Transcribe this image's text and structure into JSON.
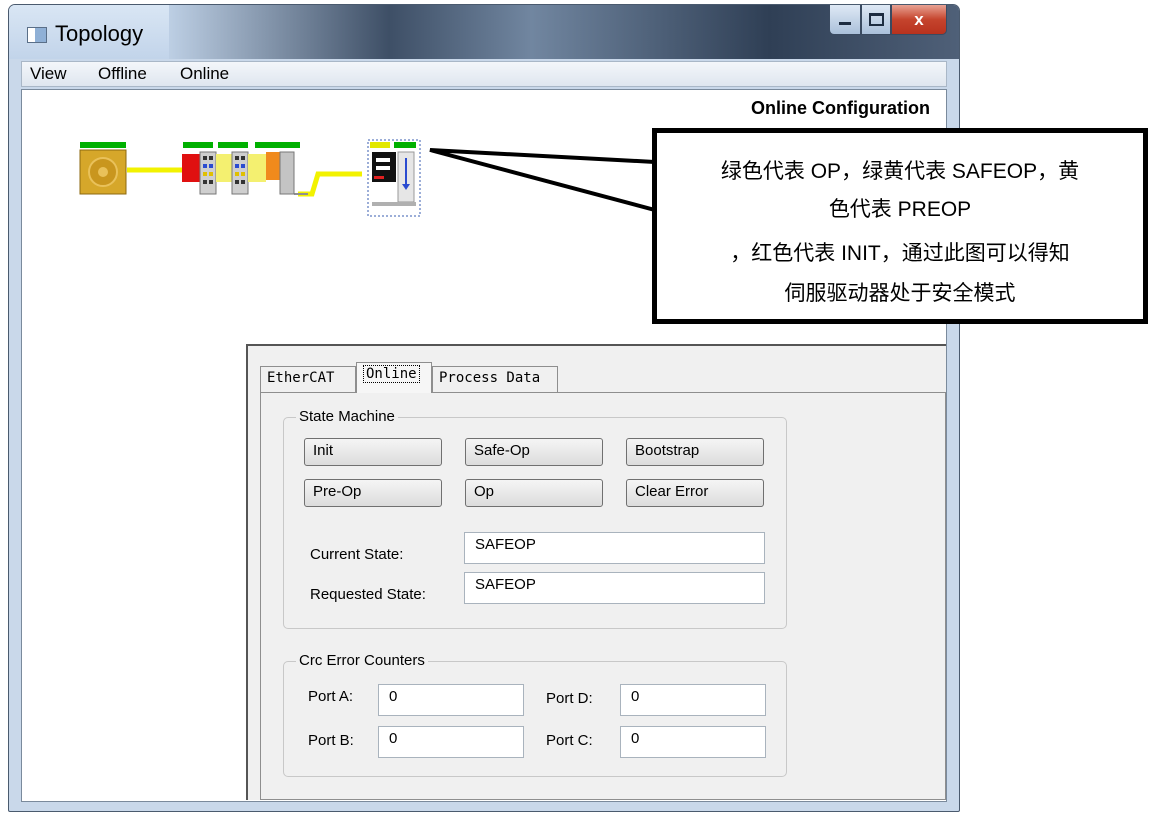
{
  "window": {
    "title": "Topology",
    "icon": "topology-window-icon",
    "controls": [
      "minimize-icon",
      "maximize-icon",
      "close-icon"
    ]
  },
  "menu": [
    "View",
    "Offline",
    "Online"
  ],
  "canvas": {
    "heading": "Online Configuration"
  },
  "topology": {
    "state_colors": {
      "OP": "#00b000",
      "SAFEOP": "#d8e600",
      "PREOP": "#ffff00",
      "INIT": "#e00000",
      "cable": "#f2f200"
    }
  },
  "tabs": [
    "EtherCAT",
    "Online",
    "Process Data"
  ],
  "active_tab": "Online",
  "state_machine": {
    "legend": "State Machine",
    "buttons": [
      "Init",
      "Safe-Op",
      "Bootstrap",
      "Pre-Op",
      "Op",
      "Clear Error"
    ],
    "current_state_label": "Current State:",
    "current_state": "SAFEOP",
    "requested_state_label": "Requested State:",
    "requested_state": "SAFEOP"
  },
  "crc_error_counters": {
    "legend": "Crc Error Counters",
    "ports": [
      {
        "label": "Port A:",
        "value": "0"
      },
      {
        "label": "Port D:",
        "value": "0"
      },
      {
        "label": "Port B:",
        "value": "0"
      },
      {
        "label": "Port C:",
        "value": "0"
      }
    ]
  },
  "callout": {
    "lines": [
      "绿色代表 OP，绿黄代表 SAFEOP，黄",
      "色代表 PREOP",
      "，红色代表 INIT，通过此图可以得知",
      "伺服驱动器处于安全模式"
    ]
  }
}
